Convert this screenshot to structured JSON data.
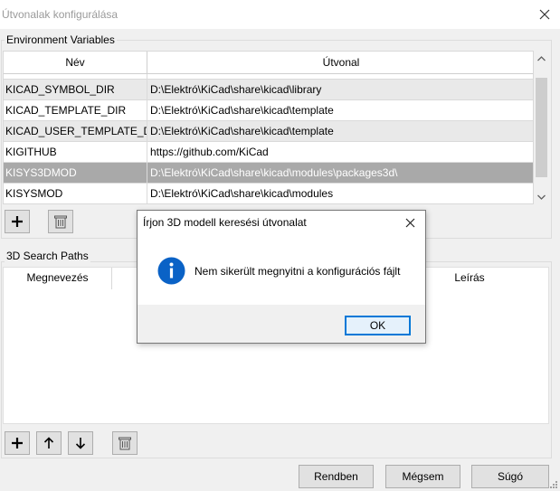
{
  "window": {
    "title": "Útvonalak konfigurálása",
    "close_icon": "close-icon"
  },
  "env_vars": {
    "group_label": "Environment Variables",
    "columns": {
      "name": "Név",
      "path": "Útvonal"
    },
    "rows": [
      {
        "name": "KICAD_SYMBOL_DIR",
        "path": "D:\\Elektró\\KiCad\\share\\kicad\\library"
      },
      {
        "name": "KICAD_TEMPLATE_DIR",
        "path": "D:\\Elektró\\KiCad\\share\\kicad\\template"
      },
      {
        "name": "KICAD_USER_TEMPLATE_DIR",
        "path": "D:\\Elektró\\KiCad\\share\\kicad\\template"
      },
      {
        "name": "KIGITHUB",
        "path": "https://github.com/KiCad"
      },
      {
        "name": "KISYS3DMOD",
        "path": "D:\\Elektró\\KiCad\\share\\kicad\\modules\\packages3d\\"
      },
      {
        "name": "KISYSMOD",
        "path": "D:\\Elektró\\KiCad\\share\\kicad\\modules"
      }
    ],
    "selected_row": "KISYS3DMOD"
  },
  "search_paths": {
    "group_label": "3D Search Paths",
    "columns": {
      "name": "Megnevezés",
      "description": "Leírás"
    }
  },
  "buttons": {
    "ok": "Rendben",
    "cancel": "Mégsem",
    "help": "Súgó"
  },
  "modal": {
    "title": "Írjon 3D modell keresési útvonalat",
    "message": "Nem sikerült megnyitni a konfigurációs fájlt",
    "ok_label": "OK",
    "icon": "info-icon"
  },
  "colors": {
    "accent": "#0078d7",
    "selected_row": "#a9a9a9",
    "info_icon": "#0a62c6"
  }
}
